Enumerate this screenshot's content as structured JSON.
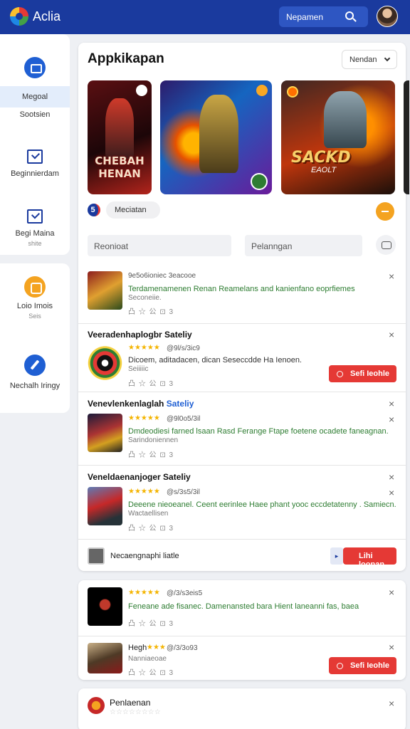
{
  "app": {
    "title": "Aclia",
    "search_placeholder": "Nepamen"
  },
  "sidebar": {
    "items": [
      {
        "label": "Megoal",
        "sub": "Sootsien"
      },
      {
        "label": "Beginnierdam"
      },
      {
        "label": "Begi Maina",
        "sub": "shite"
      },
      {
        "label": "Loio Imois",
        "sub": "Seis"
      },
      {
        "label": "Nechalh Iringy"
      }
    ]
  },
  "main": {
    "title": "Appkikapan",
    "sort": "Nendan",
    "banners": [
      {
        "text": "CHEBAH HENAN"
      },
      {
        "text": ""
      },
      {
        "text": "SACKD",
        "sub": "EAOLT"
      }
    ],
    "pill_number": "5",
    "pill_label": "Meciatan",
    "filters": [
      "Reonioat",
      "Pelanngan"
    ],
    "rows": [
      {
        "title": "",
        "meta": "9e5o6ioniec 3eacooe",
        "stars": "",
        "desc": "Terdamenamenen Renan Reamelans and kanienfano eoprfiemes",
        "desc2": "Seconeiie.",
        "acts": "凸 ☆ 公 ⊡ 3",
        "button": ""
      },
      {
        "title": "Veeradenhaplogbr Sateliy",
        "meta": "@9l/s/3ic9",
        "stars": "★★★★★",
        "desc": "Dicoem, aditadacen, dican Seseccdde Ha Ienoen.",
        "desc2": "Seiiiiic",
        "acts": "凸 ☆ 公 ⊡ 3",
        "button": "Sefi Ieohle"
      },
      {
        "title": "Venevlenkenlaglah",
        "title_accent": "Sateliy",
        "meta": "@9l0o5/3il",
        "stars": "★★★★★",
        "desc": "Dmdeodiesi farned lsaan Rasd Ferange Ftape foetene ocadete faneagnan.",
        "desc2": "Sarindoniennen",
        "acts": "凸 ☆ 公 ⊡ 3",
        "button": ""
      },
      {
        "title": "Veneldaenanjoger Sateliy",
        "meta": "@s/3s5/3il",
        "stars": "★★★★★",
        "desc": "Deeene nieoeanel. Ceent eerinlee Haee phant yooc eccdetatenny . Samiecn.",
        "desc2": "Wactaellisen",
        "acts": "凸 ☆ 公 ⊡ 3",
        "button": ""
      }
    ],
    "footer": {
      "text": "Necaengnaphi liatle",
      "arrow": "▸",
      "button": "Lihi loonan"
    }
  },
  "card2": {
    "rows": [
      {
        "stars": "★★★★★",
        "meta": "@/3/s3eis5",
        "desc": "Feneane ade fisanec. Damenansted bara Hient laneanni fas, baea",
        "acts": "凸 ☆ 公 ⊡ 3"
      },
      {
        "prefix": "Hegh",
        "stars": "★★★",
        "meta": "@/3/3o93",
        "desc2": "Nanniaeoae",
        "acts": "凸 ☆ 公 ⊡ 3",
        "button": "Sefi Ieohle"
      }
    ]
  },
  "card3": {
    "title": "Penlaenan",
    "stars": "☆☆☆☆☆☆☆☆"
  }
}
